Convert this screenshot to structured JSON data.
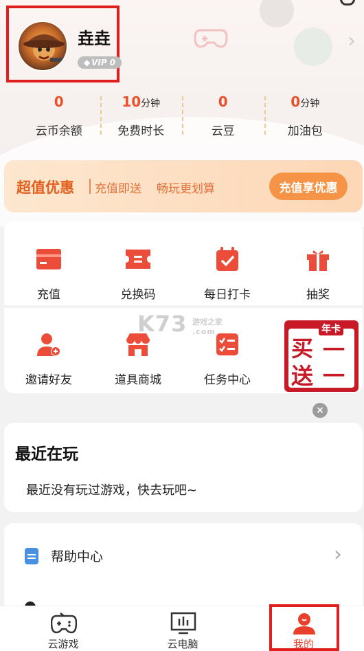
{
  "profile": {
    "username": "垚垚",
    "vip_label": "VIP 0"
  },
  "stats": [
    {
      "value": "0",
      "unit": "",
      "label": "云币余额"
    },
    {
      "value": "10",
      "unit": "分钟",
      "label": "免费时长"
    },
    {
      "value": "0",
      "unit": "",
      "label": "云豆"
    },
    {
      "value": "0",
      "unit": "分钟",
      "label": "加油包"
    }
  ],
  "promo": {
    "title": "超值优惠",
    "text1": "充值即送",
    "text2": "畅玩更划算",
    "button": "充值享优惠"
  },
  "grid": {
    "row1": [
      {
        "label": "充值",
        "icon": "card-icon"
      },
      {
        "label": "兑换码",
        "icon": "ticket-icon"
      },
      {
        "label": "每日打卡",
        "icon": "calendar-check-icon"
      },
      {
        "label": "抽奖",
        "icon": "gift-icon"
      }
    ],
    "row2": [
      {
        "label": "邀请好友",
        "icon": "add-user-icon"
      },
      {
        "label": "道具商城",
        "icon": "shop-icon"
      },
      {
        "label": "任务中心",
        "icon": "task-list-icon"
      }
    ]
  },
  "watermark": {
    "text": "K73",
    "sub": "游戏之家",
    "domain": ".com"
  },
  "stamp": {
    "tag": "年卡",
    "chars": [
      "买",
      "一",
      "送",
      "一"
    ]
  },
  "recent": {
    "title": "最近在玩",
    "empty": "最近没有玩过游戏，快去玩吧~"
  },
  "menu": {
    "items": [
      {
        "label": "帮助中心",
        "icon": "help-doc-icon"
      }
    ]
  },
  "tabbar": {
    "tabs": [
      {
        "label": "云游戏",
        "icon": "gamepad-icon"
      },
      {
        "label": "云电脑",
        "icon": "monitor-icon"
      },
      {
        "label": "我的",
        "icon": "user-icon"
      }
    ],
    "active_index": 2
  },
  "colors": {
    "accent": "#e8512a",
    "promo_text": "#e35f1d",
    "promo_button": "#f59447",
    "highlight_box": "#e01e1e",
    "tab_active": "#e8402c"
  }
}
